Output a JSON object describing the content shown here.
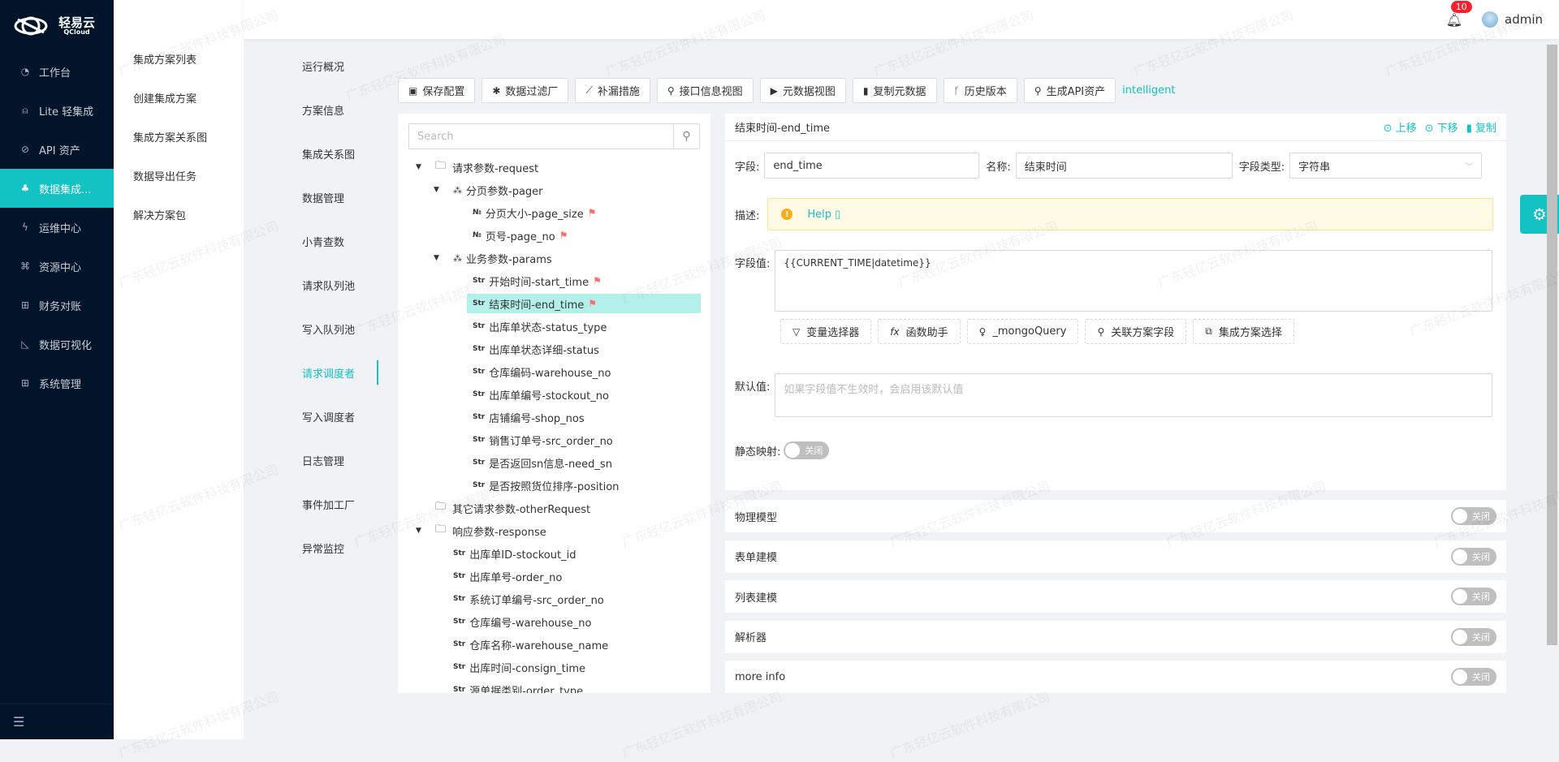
{
  "brand": {
    "name_cn": "轻易云",
    "name_en": "QCloud"
  },
  "sidebar": {
    "items": [
      {
        "label": "工作台",
        "icon": "clock-icon",
        "glyph": "◔"
      },
      {
        "label": "Lite 轻集成",
        "icon": "alarm-icon",
        "glyph": "⍝"
      },
      {
        "label": "API 资产",
        "icon": "compass-icon",
        "glyph": "⊘"
      },
      {
        "label": "数据集成...",
        "icon": "cluster-icon",
        "glyph": "♣",
        "active": true
      },
      {
        "label": "运维中心",
        "icon": "thunder-icon",
        "glyph": "ϟ"
      },
      {
        "label": "资源中心",
        "icon": "apartment-icon",
        "glyph": "⌘"
      },
      {
        "label": "财务对账",
        "icon": "calculator-icon",
        "glyph": "⊞"
      },
      {
        "label": "数据可视化",
        "icon": "area-chart-icon",
        "glyph": "◺"
      },
      {
        "label": "系统管理",
        "icon": "appstore-add-icon",
        "glyph": "⊞"
      }
    ],
    "collapse_icon": "menu-fold-icon"
  },
  "submenu": {
    "items": [
      "集成方案列表",
      "创建集成方案",
      "集成方案关系图",
      "数据导出任务",
      "解决方案包"
    ]
  },
  "header": {
    "notification_count": "10",
    "username": "admin"
  },
  "tabs": {
    "items": [
      "运行概况",
      "方案信息",
      "集成关系图",
      "数据管理",
      "小青查数",
      "请求队列池",
      "写入队列池",
      "请求调度者",
      "写入调度者",
      "日志管理",
      "事件加工厂",
      "异常监控"
    ],
    "active": "请求调度者"
  },
  "toolbar": {
    "buttons": [
      {
        "label": "保存配置",
        "icon": "save-icon",
        "glyph": "▣"
      },
      {
        "label": "数据过滤厂",
        "icon": "setting-icon",
        "glyph": "✱"
      },
      {
        "label": "补漏措施",
        "icon": "line-chart-icon",
        "glyph": "⟋"
      },
      {
        "label": "接口信息视图",
        "icon": "api-icon",
        "glyph": "⚲"
      },
      {
        "label": "元数据视图",
        "icon": "code-icon",
        "glyph": "▶"
      },
      {
        "label": "复制元数据",
        "icon": "copy-icon",
        "glyph": "▮"
      },
      {
        "label": "历史版本",
        "icon": "branches-icon",
        "glyph": "ᚴ"
      },
      {
        "label": "生成API资产",
        "icon": "api-icon",
        "glyph": "⚲"
      }
    ],
    "intelligent": "intelligent"
  },
  "tree": {
    "search_placeholder": "Search",
    "nodes": [
      {
        "label": "请求参数-request",
        "level": 0,
        "kind": "folder",
        "expanded": true
      },
      {
        "label": "分页参数-pager",
        "level": 1,
        "kind": "object",
        "expanded": true
      },
      {
        "label": "分页大小-page_size",
        "level": 2,
        "kind": "number",
        "flag": true
      },
      {
        "label": "页号-page_no",
        "level": 2,
        "kind": "number",
        "flag": true
      },
      {
        "label": "业务参数-params",
        "level": 1,
        "kind": "object",
        "expanded": true
      },
      {
        "label": "开始时间-start_time",
        "level": 2,
        "kind": "string",
        "flag": true
      },
      {
        "label": "结束时间-end_time",
        "level": 2,
        "kind": "string",
        "flag": true,
        "selected": true
      },
      {
        "label": "出库单状态-status_type",
        "level": 2,
        "kind": "string"
      },
      {
        "label": "出库单状态详细-status",
        "level": 2,
        "kind": "string"
      },
      {
        "label": "仓库编码-warehouse_no",
        "level": 2,
        "kind": "string"
      },
      {
        "label": "出库单编号-stockout_no",
        "level": 2,
        "kind": "string"
      },
      {
        "label": "店铺编号-shop_nos",
        "level": 2,
        "kind": "string"
      },
      {
        "label": "销售订单号-src_order_no",
        "level": 2,
        "kind": "string"
      },
      {
        "label": "是否返回sn信息-need_sn",
        "level": 2,
        "kind": "string"
      },
      {
        "label": "是否按照货位排序-position",
        "level": 2,
        "kind": "string"
      },
      {
        "label": "其它请求参数-otherRequest",
        "level": 0,
        "kind": "folder"
      },
      {
        "label": "响应参数-response",
        "level": 0,
        "kind": "folder",
        "expanded": true
      },
      {
        "label": "出库单ID-stockout_id",
        "level": 1,
        "kind": "string"
      },
      {
        "label": "出库单号-order_no",
        "level": 1,
        "kind": "string"
      },
      {
        "label": "系统订单编号-src_order_no",
        "level": 1,
        "kind": "string"
      },
      {
        "label": "仓库编号-warehouse_no",
        "level": 1,
        "kind": "string"
      },
      {
        "label": "仓库名称-warehouse_name",
        "level": 1,
        "kind": "string"
      },
      {
        "label": "出库时间-consign_time",
        "level": 1,
        "kind": "string"
      },
      {
        "label": "源单据类别-order_type",
        "level": 1,
        "kind": "string"
      }
    ],
    "type_labels": {
      "number": "№",
      "string": "Str"
    }
  },
  "detail": {
    "title": "结束时间-end_time",
    "actions": {
      "up": "上移",
      "down": "下移",
      "copy": "复制"
    },
    "field_label": "字段:",
    "field_value": "end_time",
    "name_label": "名称:",
    "name_value": "结束时间",
    "type_label": "字段类型:",
    "type_value": "字符串",
    "desc_label": "描述:",
    "help_text": "Help",
    "value_label": "字段值:",
    "value_text": "{{CURRENT_TIME|datetime}}",
    "helpers": [
      {
        "label": "变量选择器",
        "icon": "filter-icon",
        "glyph": "▽"
      },
      {
        "label": "函数助手",
        "icon": "function-icon",
        "glyph": "fx"
      },
      {
        "label": "_mongoQuery",
        "icon": "bulb-icon",
        "glyph": "♀"
      },
      {
        "label": "关联方案字段",
        "icon": "link-icon",
        "glyph": "⚲"
      },
      {
        "label": "集成方案选择",
        "icon": "block-icon",
        "glyph": "⧉"
      }
    ],
    "default_label": "默认值:",
    "default_placeholder": "如果字段值不生效时，会启用该默认值",
    "static_label": "静态映射:",
    "static_switch": "关闭"
  },
  "sections": [
    {
      "label": "物理模型",
      "switch": "关闭"
    },
    {
      "label": "表单建模",
      "switch": "关闭"
    },
    {
      "label": "列表建模",
      "switch": "关闭"
    },
    {
      "label": "解析器",
      "switch": "关闭"
    },
    {
      "label": "more info",
      "switch": "关闭"
    }
  ],
  "watermark": "广东轻亿云软件科技有限公司"
}
